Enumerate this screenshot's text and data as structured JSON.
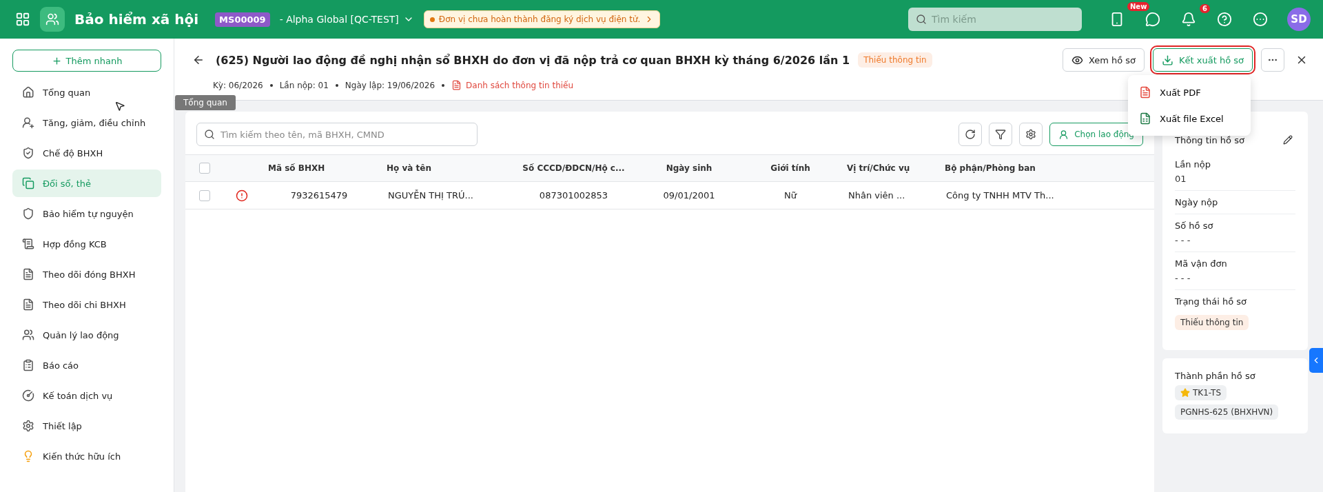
{
  "header": {
    "app_name": "Bảo hiểm xã hội",
    "org_code": "MS00009",
    "org_name": "- Alpha Global [QC-TEST]",
    "notice": "Đơn vị chưa hoàn thành đăng ký dịch vụ điện tử.",
    "search_placeholder": "Tìm kiếm",
    "new_badge": "New",
    "notification_count": "6",
    "avatar": "SD"
  },
  "sidebar": {
    "quick_add": "Thêm nhanh",
    "tooltip": "Tổng quan",
    "items": [
      {
        "label": "Tổng quan",
        "selected": false
      },
      {
        "label": "Tăng, giảm, điều chỉnh",
        "selected": false
      },
      {
        "label": "Chế độ BHXH",
        "selected": false
      },
      {
        "label": "Đổi sổ, thẻ",
        "selected": true
      },
      {
        "label": "Bảo hiểm tự nguyện",
        "selected": false
      },
      {
        "label": "Hợp đồng KCB",
        "selected": false
      },
      {
        "label": "Theo dõi đóng BHXH",
        "selected": false
      },
      {
        "label": "Theo dõi chi BHXH",
        "selected": false
      },
      {
        "label": "Quản lý lao động",
        "selected": false
      },
      {
        "label": "Báo cáo",
        "selected": false
      },
      {
        "label": "Kế toán dịch vụ",
        "selected": false
      },
      {
        "label": "Thiết lập",
        "selected": false
      },
      {
        "label": "Kiến thức hữu ích",
        "selected": false
      }
    ]
  },
  "page": {
    "title": "(625) Người lao động đề nghị nhận sổ BHXH do đơn vị đã nộp trả cơ quan BHXH kỳ tháng 6/2026 lần 1",
    "status": "Thiếu thông tin",
    "meta": [
      "Kỳ: 06/2026",
      "Lần nộp: 01",
      "Ngày lập: 19/06/2026"
    ],
    "missing_link": "Danh sách thông tin thiếu",
    "view_button": "Xem hồ sơ",
    "export_button": {
      "label": "Kết xuất hồ sơ",
      "highlighted": true
    },
    "export_menu": [
      {
        "label": "Xuất PDF",
        "kind": "pdf"
      },
      {
        "label": "Xuất file Excel",
        "kind": "excel"
      }
    ]
  },
  "table": {
    "search_placeholder": "Tìm kiếm theo tên, mã BHXH, CMND",
    "choose_button": "Chọn lao động",
    "all_checked": false,
    "columns": [
      "Mã số BHXH",
      "Họ và tên",
      "Số CCCD/ĐDCN/Hộ c...",
      "Ngày sinh",
      "Giới tính",
      "Vị trí/Chức vụ",
      "Bộ phận/Phòng ban"
    ],
    "rows": [
      {
        "checked": false,
        "warning": true,
        "cells": [
          "7932615479",
          "NGUYỄN THỊ TRÚ...",
          "087301002853",
          "09/01/2001",
          "Nữ",
          "Nhân viên ...",
          "Công ty TNHH MTV Th..."
        ]
      }
    ]
  },
  "info_panel": {
    "title": "Thông tin hồ sơ",
    "fields": [
      {
        "label": "Lần nộp",
        "value": "01"
      },
      {
        "label": "Ngày nộp"
      },
      {
        "label": "Số hồ sơ",
        "value": "- - -"
      },
      {
        "label": "Mã vận đơn",
        "value": "- - -"
      },
      {
        "label": "Trạng thái hồ sơ",
        "tag": "Thiếu thông tin"
      }
    ]
  },
  "components_panel": {
    "title": "Thành phần hồ sơ",
    "items": [
      {
        "label": "TK1-TS",
        "starred": true
      },
      {
        "label": "PGNHS-625 (BHXHVN)",
        "starred": false
      }
    ]
  }
}
